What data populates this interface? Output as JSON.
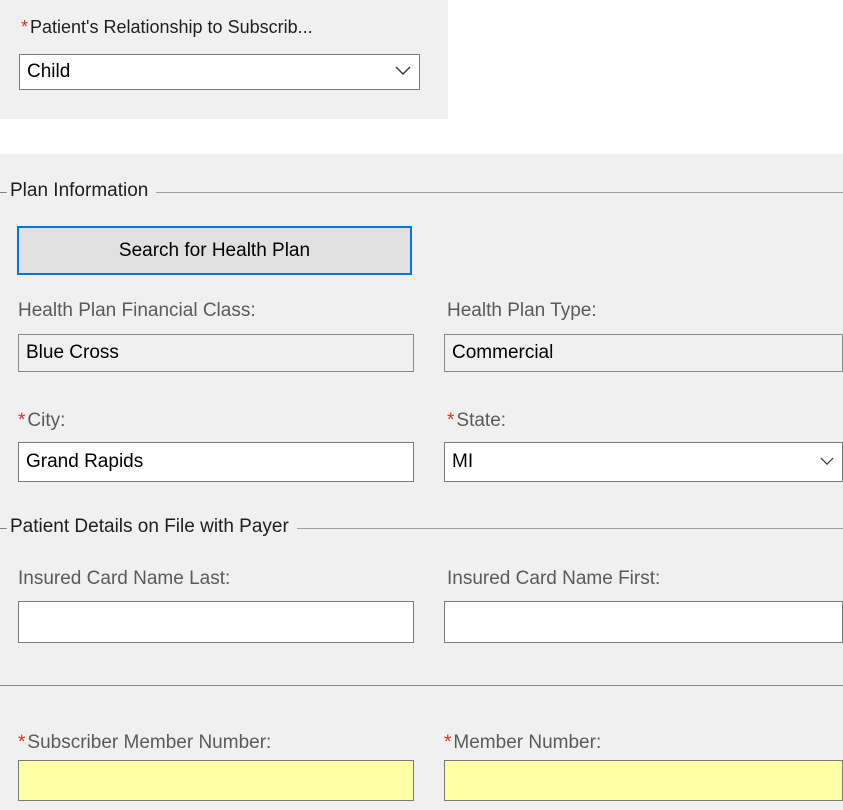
{
  "relationship": {
    "required_marker": "*",
    "label": "Patient's Relationship to Subscrib...",
    "value": "Child"
  },
  "plan_information": {
    "title": "Plan Information",
    "search_button_label": "Search for Health Plan",
    "financial_class": {
      "label": "Health Plan Financial Class:",
      "value": "Blue Cross"
    },
    "plan_type": {
      "label": "Health Plan Type:",
      "value": "Commercial"
    },
    "city": {
      "required_marker": "*",
      "label": "City:",
      "value": "Grand Rapids"
    },
    "state": {
      "required_marker": "*",
      "label": "State:",
      "value": "MI"
    }
  },
  "patient_details": {
    "title": "Patient Details on File with Payer",
    "card_name_last": {
      "label": "Insured Card Name Last:",
      "value": ""
    },
    "card_name_first": {
      "label": "Insured Card Name First:",
      "value": ""
    }
  },
  "subscriber": {
    "subscriber_member_number": {
      "required_marker": "*",
      "label": "Subscriber Member Number:",
      "value": ""
    },
    "member_number": {
      "required_marker": "*",
      "label": "Member Number:",
      "value": ""
    }
  },
  "colors": {
    "required_marker": "#e0312d",
    "required_field_bg": "#ffffa6",
    "button_border": "#0078d7",
    "panel_bg": "#f0f0f0"
  },
  "icons": {
    "dropdown": "chevron-down-icon"
  }
}
